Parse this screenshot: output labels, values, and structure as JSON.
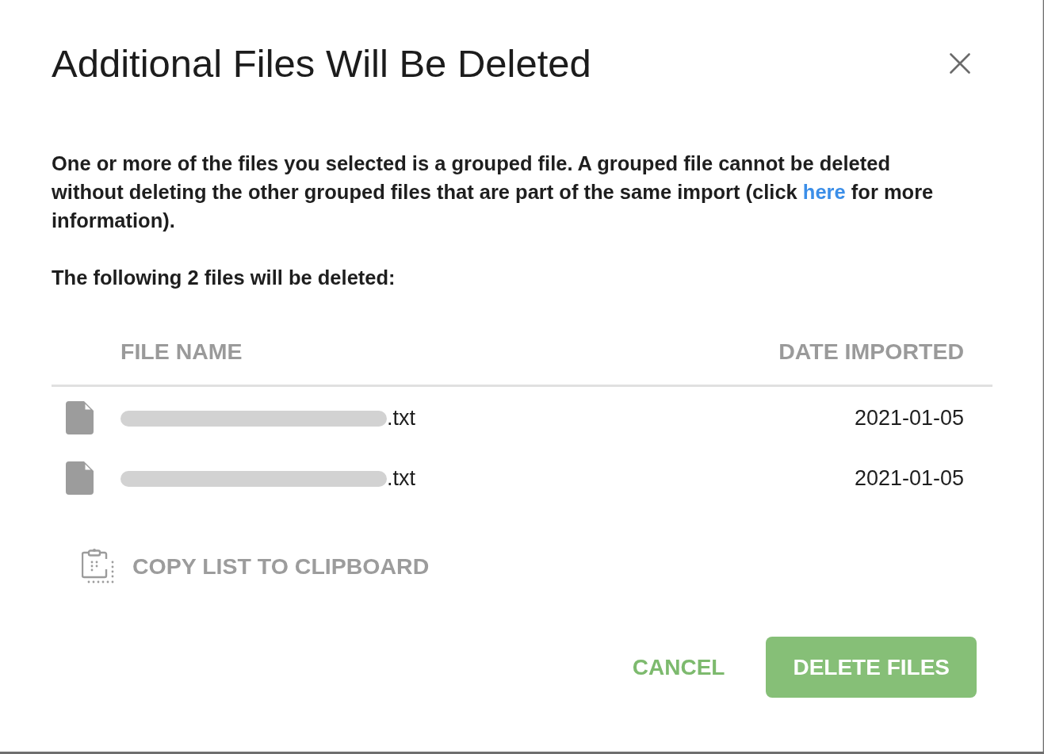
{
  "dialog": {
    "title": "Additional Files Will Be Deleted",
    "message": {
      "text_before": "One or more of the files you selected is a grouped file. A grouped file cannot be deleted without deleting the other grouped files that are part of the same import (click ",
      "link": "here",
      "text_after": " for more information)."
    },
    "summary": "The following 2 files will be deleted:",
    "table": {
      "columns": [
        "FILE NAME",
        "DATE IMPORTED"
      ],
      "rows": [
        {
          "name_redacted": true,
          "name_suffix": ".txt",
          "date_imported": "2021-01-05"
        },
        {
          "name_redacted": true,
          "name_suffix": ".txt",
          "date_imported": "2021-01-05"
        }
      ]
    },
    "copy_action": "COPY LIST TO CLIPBOARD",
    "buttons": [
      {
        "label": "CANCEL",
        "kind": "text"
      },
      {
        "label": "DELETE FILES",
        "kind": "primary"
      }
    ]
  }
}
